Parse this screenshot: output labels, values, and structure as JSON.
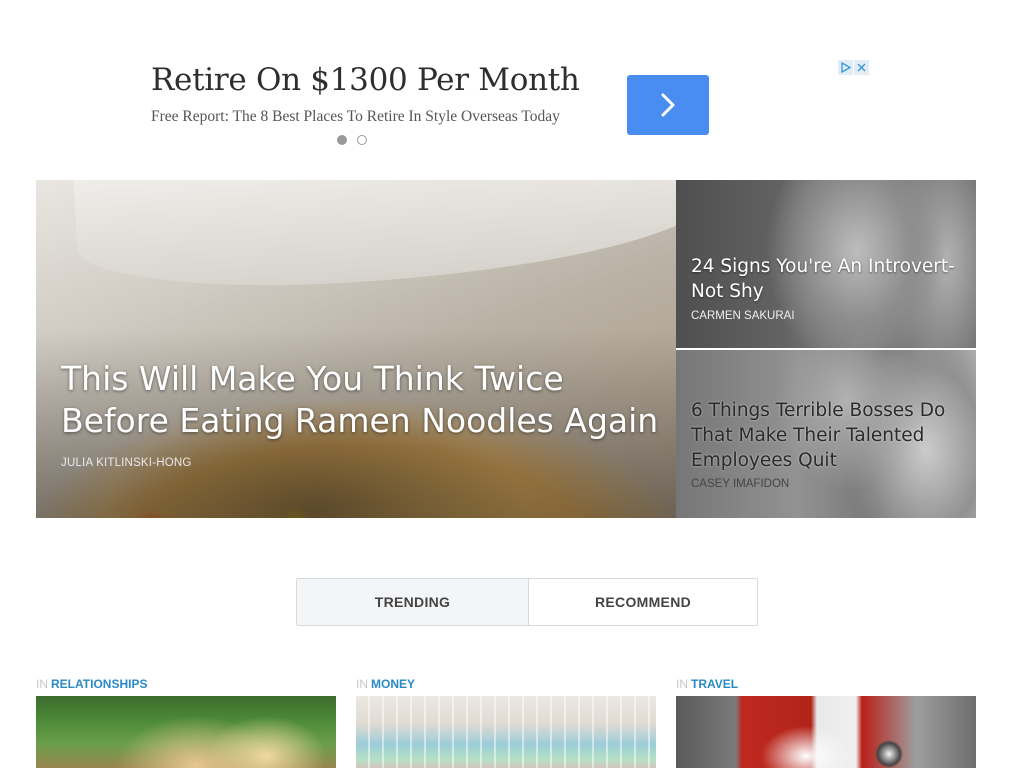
{
  "ad": {
    "title": "Retire On $1300 Per Month",
    "subtitle": "Free Report: The 8 Best Places To Retire In Style Overseas Today",
    "carousel_active_index": 0,
    "carousel_count": 2
  },
  "hero": {
    "main": {
      "title": "This Will Make You Think Twice Before Eating Ramen Noodles Again",
      "author": "JULIA KITLINSKI-HONG"
    },
    "side": [
      {
        "title": "24 Signs You're An Introvert-Not Shy",
        "author": "CARMEN SAKURAI"
      },
      {
        "title": "6 Things Terrible Bosses Do That Make Their Talented Employees Quit",
        "author": "CASEY IMAFIDON"
      }
    ]
  },
  "tabs": [
    {
      "label": "TRENDING",
      "active": true
    },
    {
      "label": "RECOMMEND",
      "active": false
    }
  ],
  "cards": [
    {
      "prefix": "IN",
      "category": "RELATIONSHIPS"
    },
    {
      "prefix": "IN",
      "category": "MONEY"
    },
    {
      "prefix": "IN",
      "category": "TRAVEL"
    }
  ],
  "colors": {
    "ad_button": "#4a8df0",
    "category_link": "#2a8ac4",
    "tab_active_bg": "#f3f5f7"
  },
  "icons": {
    "ad_button": "chevron-right-icon",
    "ad_choices": "ad-choices-icon",
    "ad_close": "close-icon"
  }
}
